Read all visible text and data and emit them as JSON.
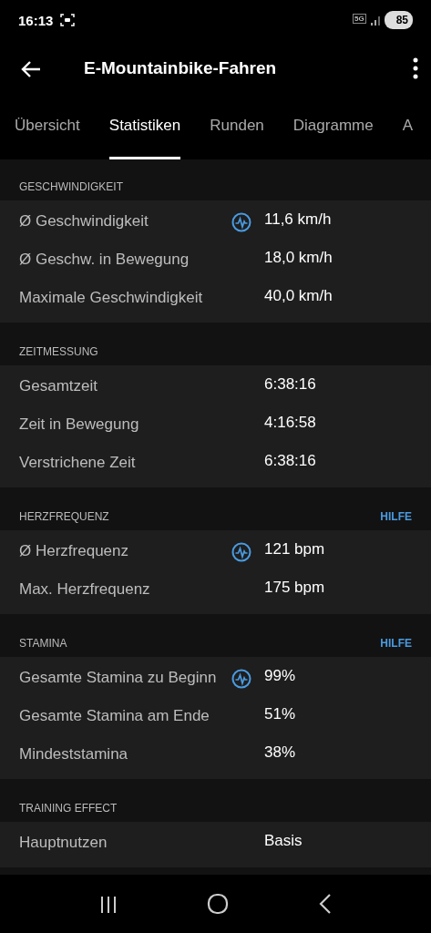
{
  "status_bar": {
    "time": "16:13",
    "network": "5G",
    "battery": "85"
  },
  "app_bar": {
    "title": "E-Mountainbike-Fahren"
  },
  "tabs": [
    {
      "label": "Übersicht",
      "selected": false
    },
    {
      "label": "Statistiken",
      "selected": true
    },
    {
      "label": "Runden",
      "selected": false
    },
    {
      "label": "Diagramme",
      "selected": false
    },
    {
      "label": "A",
      "selected": false
    }
  ],
  "sections": [
    {
      "title": "GESCHWINDIGKEIT",
      "rows": [
        {
          "label": "Ø Geschwindigkeit",
          "value": "11,6 km/h",
          "chart_icon": true
        },
        {
          "label": "Ø Geschw. in Bewegung",
          "value": "18,0 km/h",
          "chart_icon": false
        },
        {
          "label": "Maximale Geschwindigkeit",
          "value": "40,0 km/h",
          "chart_icon": false
        }
      ]
    },
    {
      "title": "ZEITMESSUNG",
      "rows": [
        {
          "label": "Gesamtzeit",
          "value": "6:38:16",
          "chart_icon": false
        },
        {
          "label": "Zeit in Bewegung",
          "value": "4:16:58",
          "chart_icon": false
        },
        {
          "label": "Verstrichene Zeit",
          "value": "6:38:16",
          "chart_icon": false
        }
      ]
    },
    {
      "title": "HERZFREQUENZ",
      "help": "HILFE",
      "rows": [
        {
          "label": "Ø Herzfrequenz",
          "value": "121 bpm",
          "chart_icon": true
        },
        {
          "label": "Max. Herzfrequenz",
          "value": "175 bpm",
          "chart_icon": false
        }
      ]
    },
    {
      "title": "STAMINA",
      "help": "HILFE",
      "rows": [
        {
          "label": "Gesamte Stamina zu Beginn",
          "value": "99%",
          "chart_icon": true
        },
        {
          "label": "Gesamte Stamina am Ende",
          "value": "51%",
          "chart_icon": false
        },
        {
          "label": "Mindeststamina",
          "value": "38%",
          "chart_icon": false
        }
      ]
    },
    {
      "title": "TRAINING EFFECT",
      "rows": [
        {
          "label": "Hauptnutzen",
          "value": "Basis",
          "chart_icon": false
        }
      ]
    }
  ]
}
